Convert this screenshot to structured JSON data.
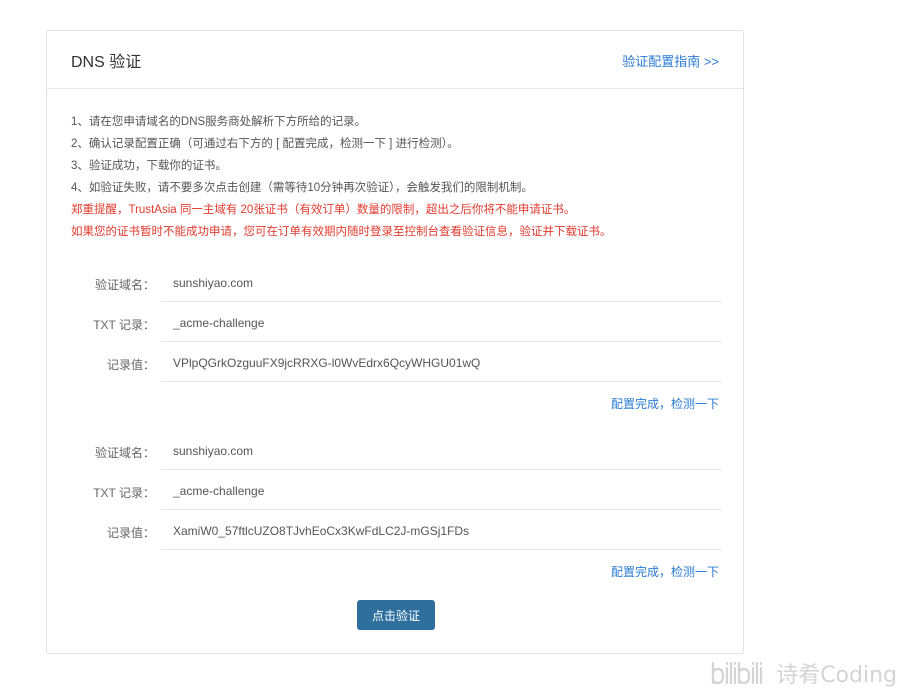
{
  "header": {
    "title": "DNS 验证",
    "guide_link": "验证配置指南 >>"
  },
  "instructions": [
    "1、请在您申请域名的DNS服务商处解析下方所给的记录。",
    "2、确认记录配置正确（可通过右下方的 [ 配置完成，检测一下 ] 进行检测）。",
    "3、验证成功，下载你的证书。",
    "4、如验证失败，请不要多次点击创建（需等待10分钟再次验证），会触发我们的限制机制。"
  ],
  "warnings": [
    "郑重提醒，TrustAsia 同一主域有 20张证书（有效订单）数量的限制，超出之后你将不能申请证书。",
    "如果您的证书暂时不能成功申请，您可在订单有效期内随时登录至控制台查看验证信息，验证并下载证书。"
  ],
  "labels": {
    "domain": "验证域名：",
    "txt": "TXT 记录：",
    "value": "记录值："
  },
  "records": [
    {
      "domain": "sunshiyao.com",
      "txt": "_acme-challenge",
      "value": "VPlpQGrkOzguuFX9jcRRXG-l0WvEdrx6QcyWHGU01wQ",
      "check_label": "配置完成，检测一下"
    },
    {
      "domain": "sunshiyao.com",
      "txt": "_acme-challenge",
      "value": "XamiW0_57ftlcUZO8TJvhEoCx3KwFdLC2J-mGSj1FDs",
      "check_label": "配置完成，检测一下"
    }
  ],
  "verify_button": "点击验证",
  "watermark": {
    "text": "诗肴Coding",
    "logo_icon": "bilibili-logo-icon"
  }
}
